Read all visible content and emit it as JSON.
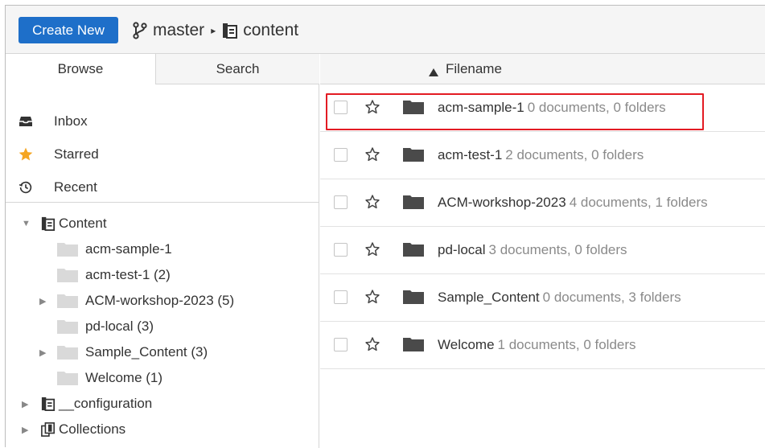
{
  "toolbar": {
    "create_label": "Create New"
  },
  "breadcrumb": {
    "branch": "master",
    "sep": "▸",
    "location": "content"
  },
  "tabs": {
    "browse": "Browse",
    "search": "Search"
  },
  "quick_links": [
    {
      "label": "Inbox",
      "icon": "inbox-icon"
    },
    {
      "label": "Starred",
      "icon": "star-icon"
    },
    {
      "label": "Recent",
      "icon": "history-icon"
    }
  ],
  "tree": {
    "content": "Content",
    "children": [
      {
        "label": "acm-sample-1",
        "expandable": false
      },
      {
        "label": "acm-test-1 (2)",
        "expandable": false
      },
      {
        "label": "ACM-workshop-2023 (5)",
        "expandable": true
      },
      {
        "label": "pd-local (3)",
        "expandable": false
      },
      {
        "label": "Sample_Content (3)",
        "expandable": true
      },
      {
        "label": "Welcome (1)",
        "expandable": false
      }
    ],
    "configuration": "__configuration",
    "collections": "Collections"
  },
  "list": {
    "column": "Filename",
    "rows": [
      {
        "name": "acm-sample-1",
        "meta": "0 documents, 0 folders",
        "highlighted": true
      },
      {
        "name": "acm-test-1",
        "meta": "2 documents, 0 folders"
      },
      {
        "name": "ACM-workshop-2023",
        "meta": "4 documents, 1 folders"
      },
      {
        "name": "pd-local",
        "meta": "3 documents, 0 folders"
      },
      {
        "name": "Sample_Content",
        "meta": "0 documents, 3 folders"
      },
      {
        "name": "Welcome",
        "meta": "1 documents, 0 folders"
      }
    ]
  },
  "colors": {
    "accent": "#1e6fc9",
    "star": "#f5a623",
    "folder": "#4a4a4a",
    "highlight": "#e31b23"
  }
}
